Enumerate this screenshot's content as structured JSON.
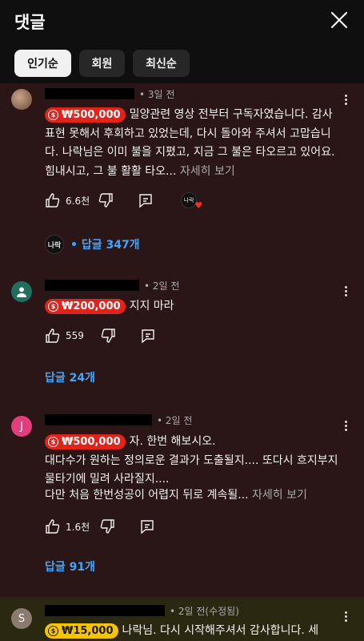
{
  "header": {
    "title": "댓글"
  },
  "chips": [
    {
      "label": "인기순",
      "active": true
    },
    {
      "label": "회원",
      "active": false
    },
    {
      "label": "최신순",
      "active": false
    }
  ],
  "comments": [
    {
      "time": "• 3일 전",
      "badge": "₩500,000",
      "text": "밀양관련 영상 전부터 구독자였습니다. 감사표현 못해서 후회하고 있었는데, 다시 돌아와 주셔서 고맙습니다. 나락님은 이미 불을 지폈고, 지금 그 불은 타오르고 있어요. 힘내시고, 그 불 활활 타오...",
      "read_more": "자세히 보기",
      "likes": "6.6천",
      "creator_avatar_text": "나락",
      "replies": "• 답글 347개"
    },
    {
      "time": "• 2일 전",
      "badge": "₩200,000",
      "text": "지지 마라",
      "likes": "559",
      "replies": "답글 24개"
    },
    {
      "avatar_letter": "J",
      "time": "• 2일 전",
      "badge": "₩500,000",
      "text_lines": [
        "자. 한번 해보시오.",
        "대다수가 원하는 정의로운 결과가 도출될지.... 또다시 흐지부지 물타기에 밀려 사라질지....",
        "다만 처음 한번성공이 어렵지 뒤로 계속될..."
      ],
      "read_more": "자세히 보기",
      "likes": "1.6천",
      "replies": "답글 91개"
    },
    {
      "avatar_letter": "S",
      "time": "• 2일 전(수정됨)",
      "badge": "₩15,000",
      "text": "나락님. 다시 시작해주셔서 감사합니다. 세"
    }
  ]
}
